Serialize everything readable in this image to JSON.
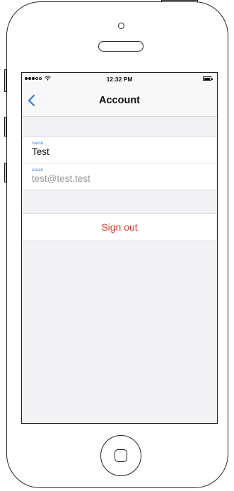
{
  "status_bar": {
    "time": "12:32 PM",
    "signal_icon": "signal-dots-icon",
    "wifi_icon": "wifi-icon",
    "battery_icon": "battery-icon"
  },
  "nav": {
    "title": "Account",
    "back_icon": "chevron-left-icon"
  },
  "fields": [
    {
      "label": "name",
      "value": "Test"
    },
    {
      "label": "email",
      "value": "test@test.test"
    }
  ],
  "actions": {
    "sign_out_label": "Sign out"
  },
  "colors": {
    "accent": "#3b8fe8",
    "destructive": "#e0392f",
    "background": "#f2f2f4"
  }
}
